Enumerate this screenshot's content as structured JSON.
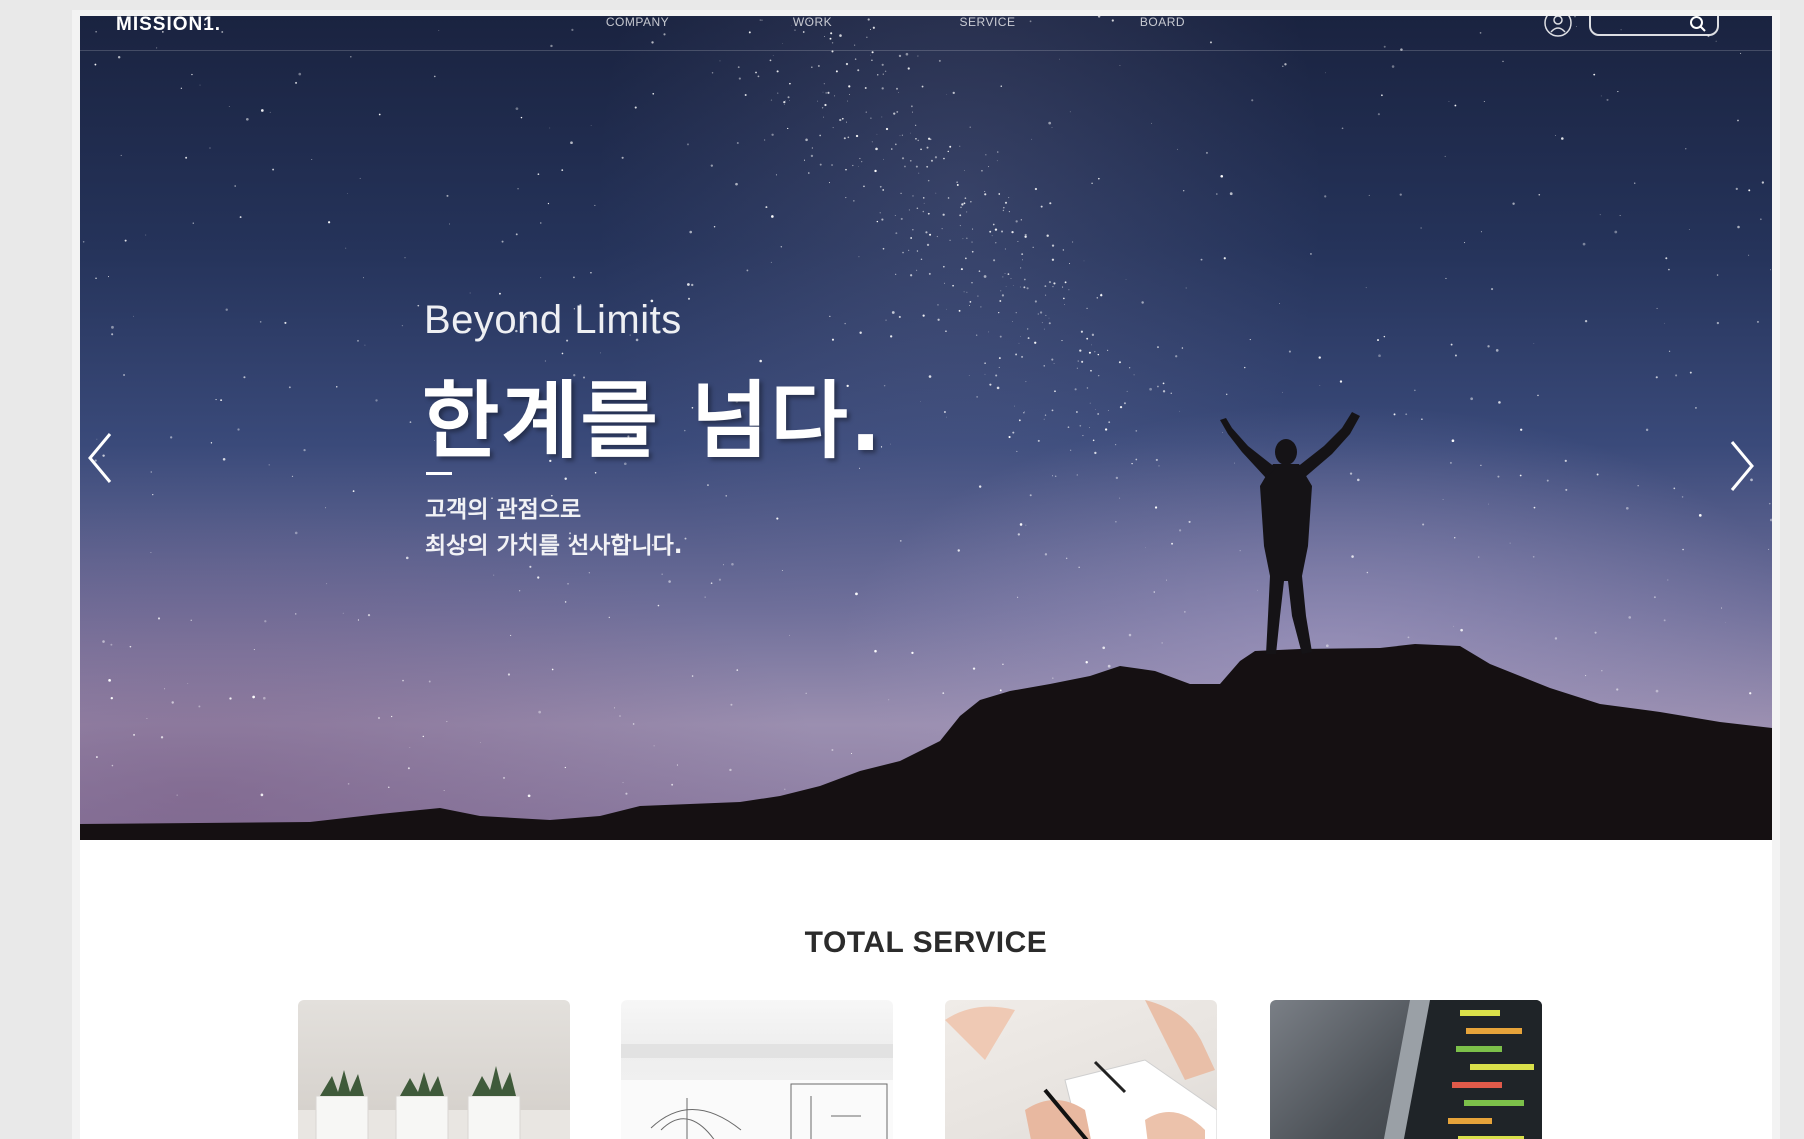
{
  "header": {
    "logo": "MISSION1.",
    "nav": [
      "COMPANY",
      "WORK",
      "SERVICE",
      "BOARD"
    ],
    "search_placeholder": ""
  },
  "hero": {
    "title_en": "Beyond Limits",
    "title_ko": "한계를 넘다.",
    "subtitle_lines": [
      "고객의 관점으로",
      "최상의 가치를 선사합니다."
    ]
  },
  "service": {
    "title": "TOTAL SERVICE",
    "cards": [
      {
        "image": "potted-plants"
      },
      {
        "image": "sketch-drawing"
      },
      {
        "image": "writing-notebook"
      },
      {
        "image": "data-screen"
      }
    ]
  },
  "icons": {
    "user": "user-icon",
    "search": "search-icon",
    "prev": "chevron-left-icon",
    "next": "chevron-right-icon"
  }
}
